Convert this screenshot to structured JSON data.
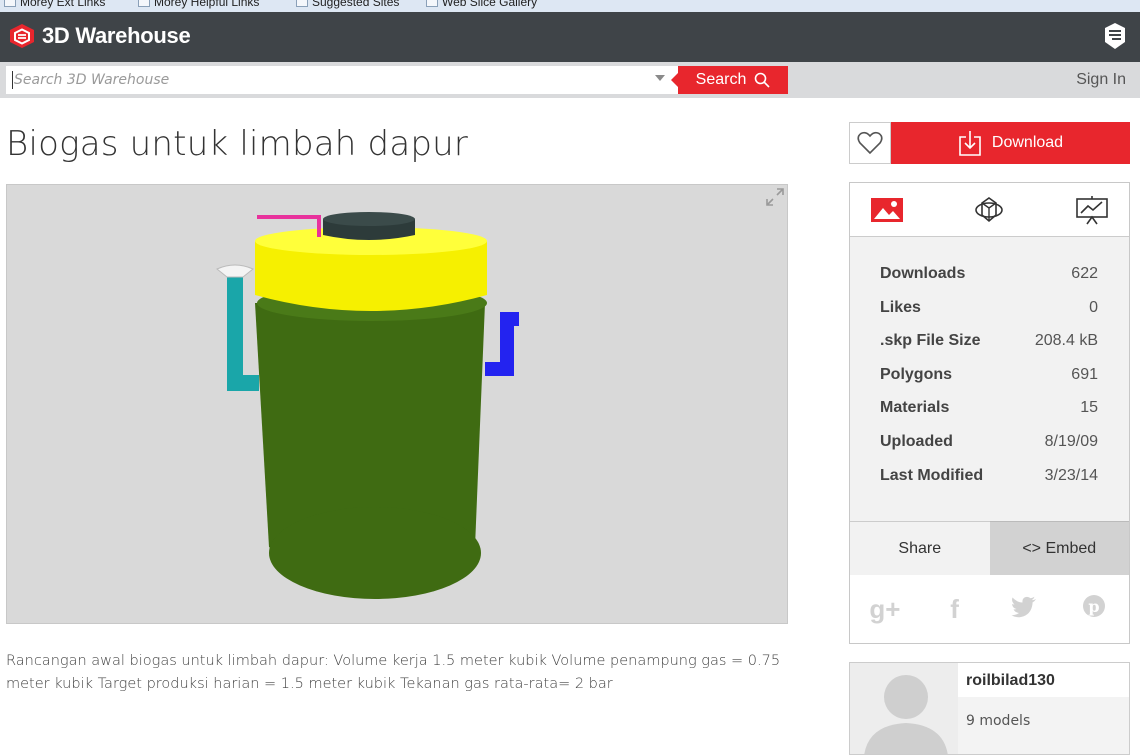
{
  "bookmarks": [
    {
      "label": "Morey Ext Links"
    },
    {
      "label": "Morey Helpful Links"
    },
    {
      "label": "Suggested Sites"
    },
    {
      "label": "Web Slice Gallery"
    }
  ],
  "header": {
    "logo_text": "3D Warehouse",
    "brand_color": "#e8262d",
    "bar_color": "#3f4448"
  },
  "search": {
    "placeholder": "Search 3D Warehouse",
    "button_label": "Search",
    "sign_in_label": "Sign In"
  },
  "model": {
    "title": "Biogas untuk limbah dapur",
    "description": "Rancangan awal biogas untuk limbah dapur: Volume kerja 1.5 meter kubik Volume penampung gas = 0.75 meter kubik Target produksi harian = 1.5 meter kubik Tekanan gas rata-rata= 2 bar"
  },
  "actions": {
    "download_label": "Download"
  },
  "view_tabs": [
    {
      "icon": "image-icon",
      "active": true
    },
    {
      "icon": "3d-view-icon",
      "active": false
    },
    {
      "icon": "presentation-icon",
      "active": false
    }
  ],
  "stats": [
    {
      "label": "Downloads",
      "value": "622"
    },
    {
      "label": "Likes",
      "value": "0"
    },
    {
      "label": ".skp File Size",
      "value": "208.4 kB"
    },
    {
      "label": "Polygons",
      "value": "691"
    },
    {
      "label": "Materials",
      "value": "15"
    },
    {
      "label": "Uploaded",
      "value": "8/19/09"
    },
    {
      "label": "Last Modified",
      "value": "3/23/14"
    }
  ],
  "share": {
    "share_label": "Share",
    "embed_label": "<> Embed",
    "social": [
      "g+",
      "f",
      "twitter",
      "p"
    ]
  },
  "author": {
    "username": "roilbilad130",
    "models": "9 models"
  }
}
